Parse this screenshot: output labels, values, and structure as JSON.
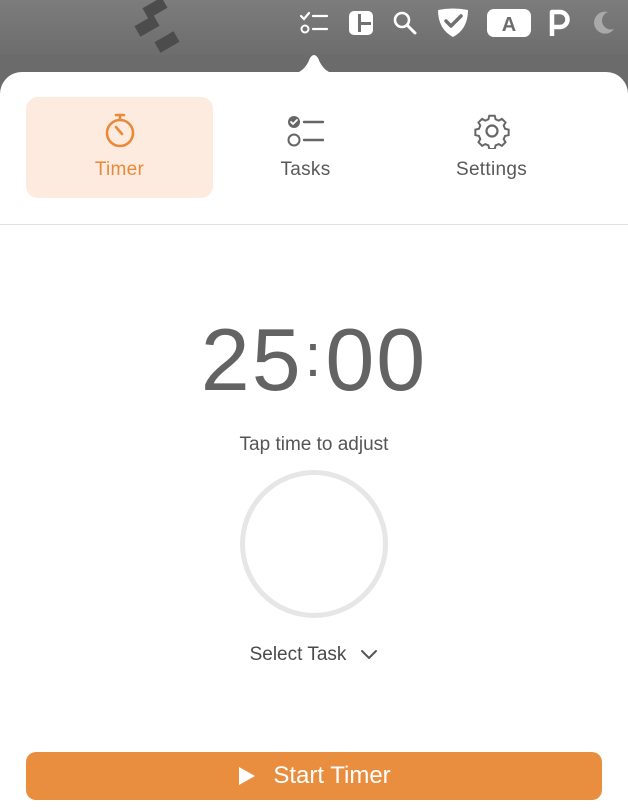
{
  "menubar": {
    "icons": [
      "tasks-icon",
      "layout-icon",
      "search-icon",
      "shield-check-icon",
      "a-badge-icon",
      "p-icon",
      "moon-icon"
    ],
    "badge_letter": "A"
  },
  "tabs": [
    {
      "label": "Timer",
      "icon": "stopwatch-icon",
      "active": true
    },
    {
      "label": "Tasks",
      "icon": "checklist-icon",
      "active": false
    },
    {
      "label": "Settings",
      "icon": "gear-icon",
      "active": false
    }
  ],
  "timer": {
    "minutes": "25",
    "separator": ":",
    "seconds": "00",
    "hint": "Tap time to adjust",
    "progress": 0
  },
  "task_select": {
    "label": "Select Task"
  },
  "start_button": {
    "label": "Start Timer"
  },
  "colors": {
    "accent": "#e98e3f",
    "active_tab_bg": "#fcebde",
    "text": "#636363"
  }
}
